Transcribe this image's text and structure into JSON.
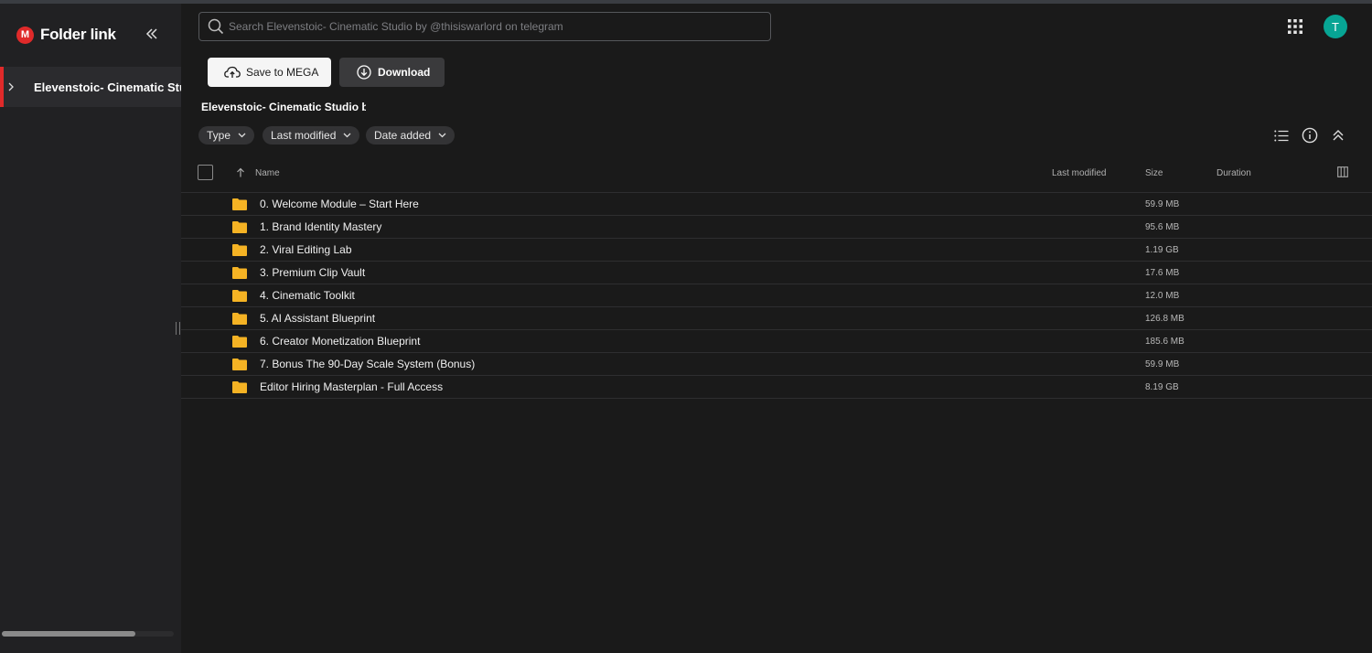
{
  "app": {
    "title": "Folder link",
    "logo_letter": "M"
  },
  "sidebar": {
    "tree_item_label": "Elevenstoic- Cinematic Studio by"
  },
  "search": {
    "placeholder": "Search Elevenstoic- Cinematic Studio by @thisiswarlord on telegram"
  },
  "user": {
    "avatar_initial": "T",
    "avatar_color": "#07a594"
  },
  "actions": {
    "save_label": "Save to MEGA",
    "download_label": "Download"
  },
  "folder": {
    "title": "Elevenstoic- Cinematic Studio by"
  },
  "filters": {
    "type": "Type",
    "last_modified": "Last modified",
    "date_added": "Date added"
  },
  "columns": {
    "name": "Name",
    "last_modified": "Last modified",
    "size": "Size",
    "duration": "Duration"
  },
  "files": [
    {
      "name": "0. Welcome Module – Start Here",
      "size": "59.9 MB"
    },
    {
      "name": "1. Brand Identity Mastery",
      "size": "95.6 MB"
    },
    {
      "name": "2. Viral Editing Lab",
      "size": "1.19 GB"
    },
    {
      "name": "3. Premium Clip Vault",
      "size": "17.6 MB"
    },
    {
      "name": "4. Cinematic Toolkit",
      "size": "12.0 MB"
    },
    {
      "name": "5. AI Assistant Blueprint",
      "size": "126.8 MB"
    },
    {
      "name": "6. Creator Monetization Blueprint",
      "size": "185.6 MB"
    },
    {
      "name": "7. Bonus The 90-Day Scale System (Bonus)",
      "size": "59.9 MB"
    },
    {
      "name": "Editor Hiring Masterplan - Full Access",
      "size": "8.19 GB"
    }
  ],
  "colors": {
    "accent": "#e02a2a",
    "folder": "#f5b324"
  }
}
